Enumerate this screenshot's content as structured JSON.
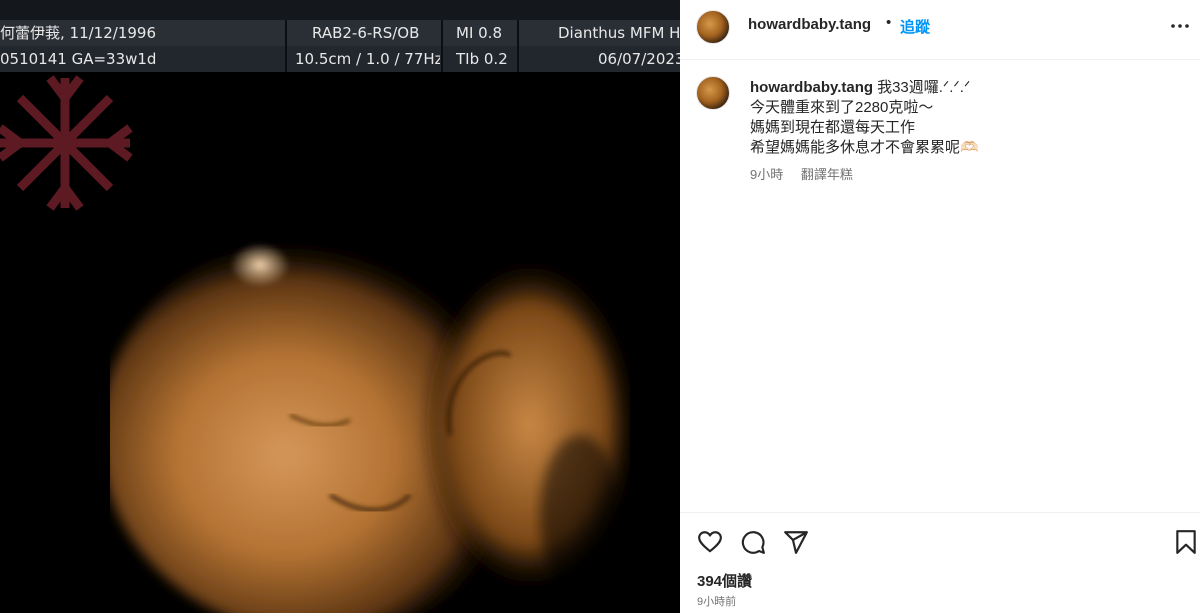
{
  "ultrasound": {
    "patient": "何蕾伊莪, 11/12/1996",
    "probe": "RAB2-6-RS/OB",
    "mi": "MI 0.8",
    "clinic": "Dianthus MFM H",
    "id_ga": "0510141 GA=33w1d",
    "scan": "10.5cm / 1.0 / 77Hz",
    "tib": "TIb 0.2",
    "date": "06/07/2023"
  },
  "header": {
    "username": "howardbaby.tang",
    "dot": "•",
    "follow_label": "追蹤"
  },
  "caption": {
    "username": "howardbaby.tang",
    "lines": [
      "我33週囉.ᐟ.ᐟ.ᐟ",
      "今天體重來到了2280克啦～",
      "媽媽到現在都還每天工作",
      "希望媽媽能多休息才不會累累呢🫶🏻"
    ],
    "time": "9小時",
    "translate": "翻譯年糕"
  },
  "stats": {
    "views": "394個讚",
    "time_ago": "9小時前"
  },
  "colors": {
    "link_blue": "#0095f6",
    "skin_tone": "#c8834a",
    "logo_red": "#6e1f2a"
  },
  "icons": [
    "heart-icon",
    "comment-icon",
    "share-icon",
    "bookmark-icon",
    "more-icon"
  ]
}
